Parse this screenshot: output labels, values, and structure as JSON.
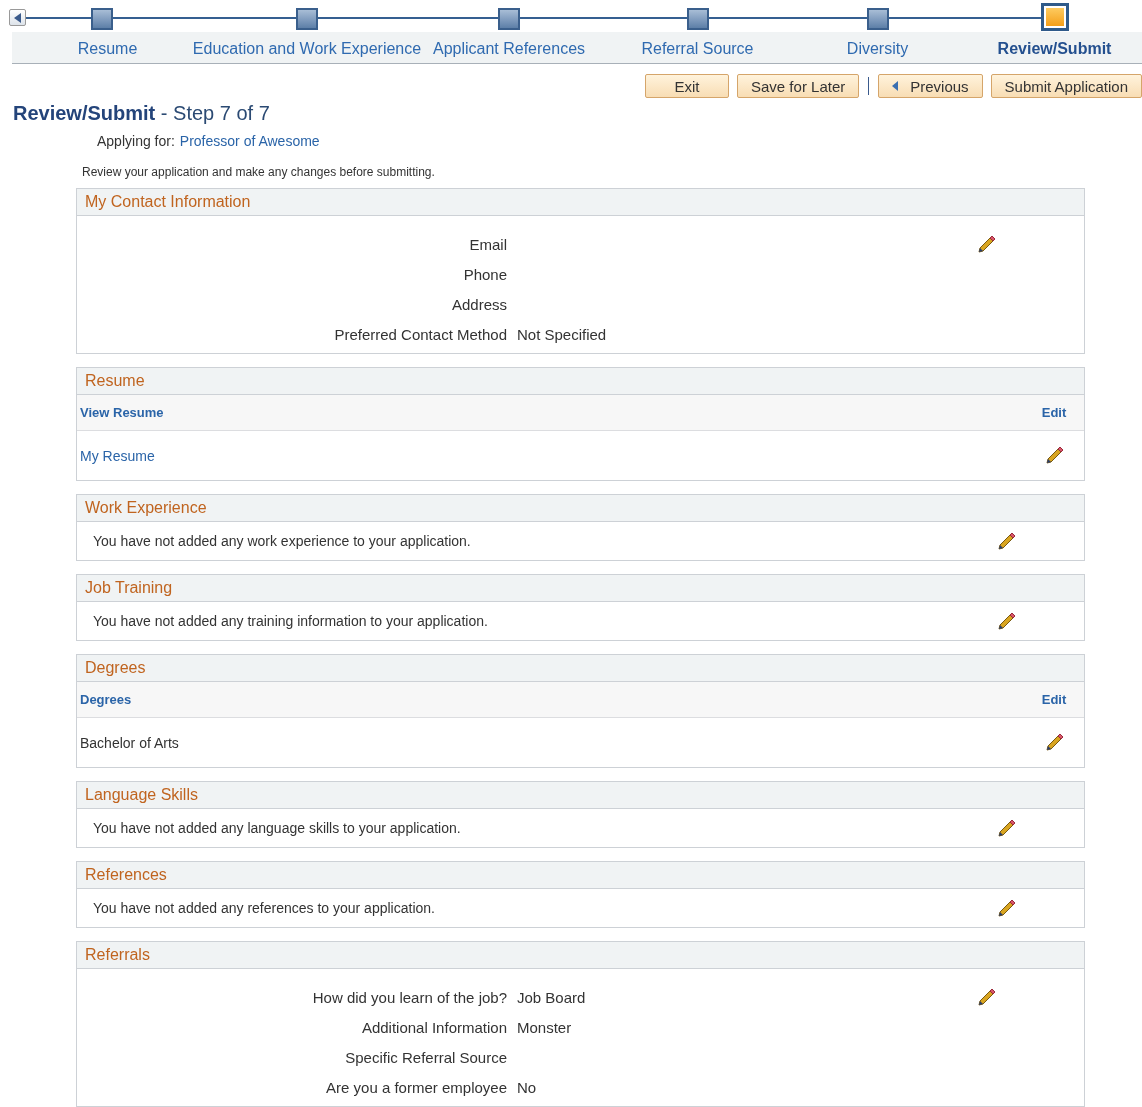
{
  "steps": [
    {
      "label": "Resume",
      "selected": false
    },
    {
      "label": "Education and Work Experience",
      "selected": false
    },
    {
      "label": "Applicant References",
      "selected": false
    },
    {
      "label": "Referral Source",
      "selected": false
    },
    {
      "label": "Diversity",
      "selected": false
    },
    {
      "label": "Review/Submit",
      "selected": true
    }
  ],
  "buttons": [
    {
      "label": "Exit",
      "kind": "plain"
    },
    {
      "label": "Save for Later",
      "kind": "plain"
    },
    {
      "label": "Previous",
      "kind": "previous"
    },
    {
      "label": "Submit Application",
      "kind": "plain"
    }
  ],
  "page_title": "Review/Submit",
  "step_text": "- Step 7 of 7",
  "applying_for": {
    "label": "Applying for:",
    "value": "Professor of Awesome"
  },
  "instructions": "Review your application and make any changes before submitting.",
  "sections": [
    {
      "kind": "fields",
      "title": "My Contact Information",
      "fields": [
        {
          "label": "Email"
        },
        {
          "label": "Phone"
        },
        {
          "label": "Address"
        },
        {
          "label": "Preferred Contact Method",
          "value": "Not Specified"
        }
      ]
    },
    {
      "kind": "grid",
      "title": "Resume",
      "columns": [
        "View Resume",
        "Edit"
      ],
      "rows": [
        {
          "text": "My Resume",
          "link": true
        }
      ]
    },
    {
      "kind": "message",
      "title": "Work Experience",
      "message": "You have not added any work experience to your application."
    },
    {
      "kind": "message",
      "title": "Job Training",
      "message": "You have not added any training information to your application."
    },
    {
      "kind": "grid",
      "title": "Degrees",
      "columns": [
        "Degrees",
        "Edit"
      ],
      "rows": [
        {
          "text": "Bachelor of Arts",
          "link": false
        }
      ]
    },
    {
      "kind": "message",
      "title": "Language Skills",
      "message": "You have not added any language skills to your application."
    },
    {
      "kind": "message",
      "title": "References",
      "message": "You have not added any references to your application."
    },
    {
      "kind": "fields",
      "title": "Referrals",
      "fields": [
        {
          "label": "How did you learn of the job?",
          "value": "Job Board"
        },
        {
          "label": "Additional Information",
          "value": "Monster"
        },
        {
          "label": "Specific Referral Source"
        },
        {
          "label": "Are you a former employee",
          "value": "No"
        }
      ]
    }
  ]
}
